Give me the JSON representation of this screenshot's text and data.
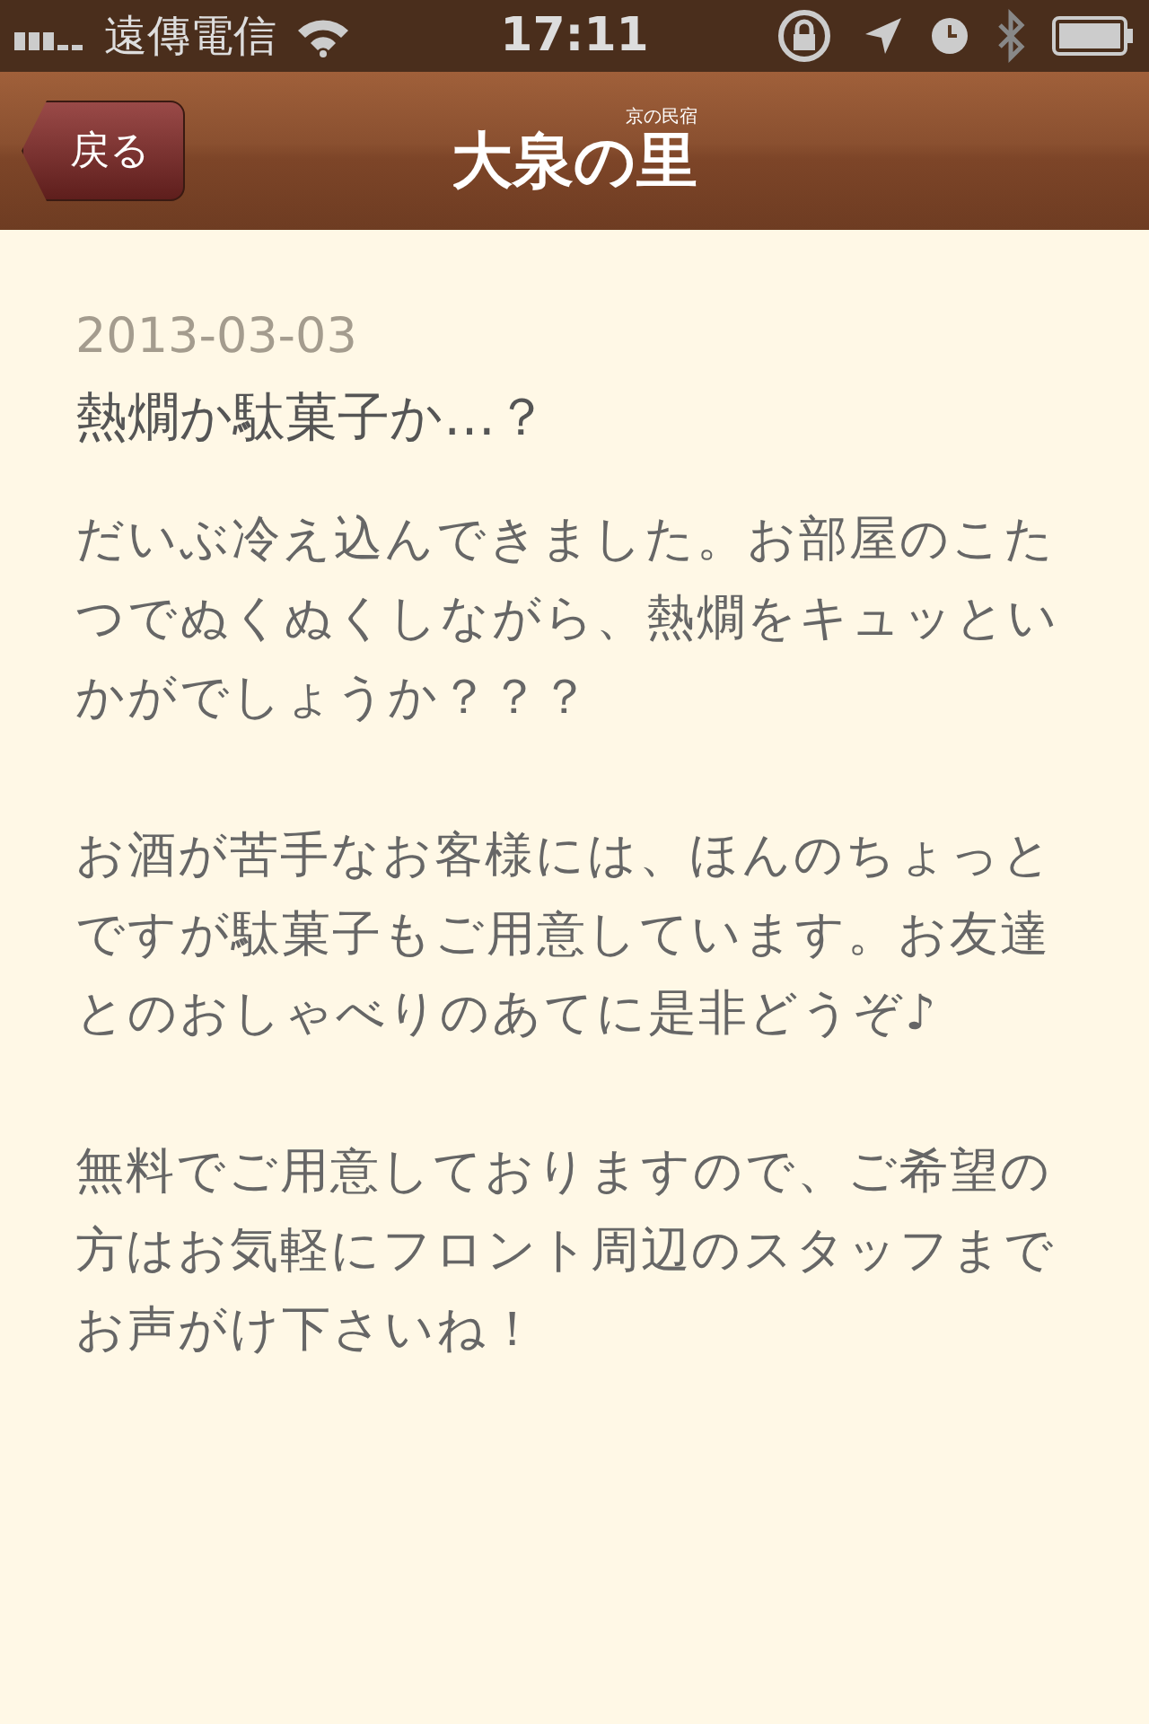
{
  "status_bar": {
    "carrier": "遠傳電信",
    "time": "17:11"
  },
  "nav_bar": {
    "back_button": "戻る",
    "logo_small": "京の民宿",
    "logo": "大泉の里"
  },
  "post": {
    "date": "2013-03-03",
    "title": "熱燗か駄菓子か…？",
    "paragraphs": [
      "だいぶ冷え込んできました。お部屋のこたつでぬくぬくしながら、熱燗をキュッといかがでしょうか？？？",
      "お酒が苦手なお客様には、ほんのちょっとですが駄菓子もご用意しています。お友達とのおしゃべりのあてに是非どうぞ♪",
      "無料でご用意しておりますので、ご希望の方はお気軽にフロント周辺のスタッフまでお声がけ下さいね！"
    ]
  }
}
